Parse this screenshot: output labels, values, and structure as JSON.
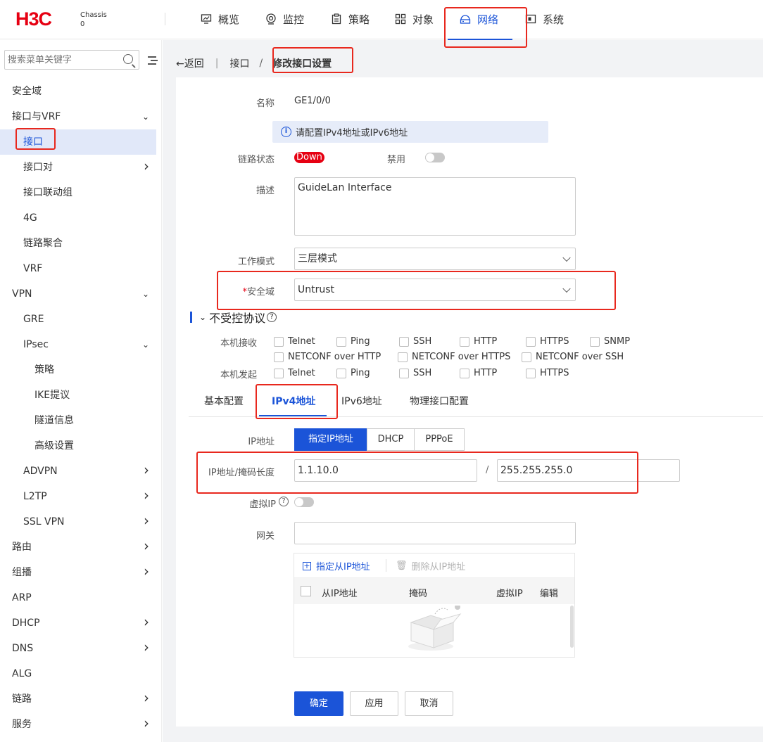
{
  "header": {
    "logo": "H3C",
    "chassis_label": "Chassis",
    "chassis_value": "0",
    "nav": [
      {
        "label": "概览",
        "icon": "monitor-icon"
      },
      {
        "label": "监控",
        "icon": "eye-icon"
      },
      {
        "label": "策略",
        "icon": "clipboard-icon"
      },
      {
        "label": "对象",
        "icon": "grid-icon"
      },
      {
        "label": "网络",
        "icon": "network-icon",
        "active": true
      },
      {
        "label": "系统",
        "icon": "system-icon"
      }
    ]
  },
  "sidebar": {
    "search_placeholder": "搜索菜单关键字",
    "items": [
      {
        "label": "安全域"
      },
      {
        "label": "接口与VRF",
        "chevron": "⌄"
      },
      {
        "label": "接口",
        "selected": true
      },
      {
        "label": "接口对",
        "chevron": "›"
      },
      {
        "label": "接口联动组"
      },
      {
        "label": "4G"
      },
      {
        "label": "链路聚合"
      },
      {
        "label": "VRF"
      },
      {
        "label": "VPN",
        "chevron": "⌄"
      },
      {
        "label": "GRE"
      },
      {
        "label": "IPsec",
        "chevron": "⌄"
      },
      {
        "label": "策略"
      },
      {
        "label": "IKE提议"
      },
      {
        "label": "隧道信息"
      },
      {
        "label": "高级设置"
      },
      {
        "label": "ADVPN",
        "chevron": "›"
      },
      {
        "label": "L2TP",
        "chevron": "›"
      },
      {
        "label": "SSL VPN",
        "chevron": "›"
      },
      {
        "label": "路由",
        "chevron": "›"
      },
      {
        "label": "组播",
        "chevron": "›"
      },
      {
        "label": "ARP"
      },
      {
        "label": "DHCP",
        "chevron": "›"
      },
      {
        "label": "DNS",
        "chevron": "›"
      },
      {
        "label": "ALG"
      },
      {
        "label": "链路",
        "chevron": "›"
      },
      {
        "label": "服务",
        "chevron": "›"
      }
    ]
  },
  "breadcrumb": {
    "back": "←返回",
    "sep1": "|",
    "level1": "接口",
    "sep2": "/",
    "current": "修改接口设置"
  },
  "form": {
    "name_label": "名称",
    "name_value": "GE1/0/0",
    "info": "请配置IPv4地址或IPv6地址",
    "link_status_label": "链路状态",
    "link_status_value": "Down",
    "disable_label": "禁用",
    "desc_label": "描述",
    "desc_value": "GuideLan Interface",
    "mode_label": "工作模式",
    "mode_value": "三层模式",
    "zone_required": "*",
    "zone_label": "安全域",
    "zone_value": "Untrust"
  },
  "protocols": {
    "title": "不受控协议",
    "help": "?",
    "receive_label": "本机接收",
    "receive": [
      "Telnet",
      "Ping",
      "SSH",
      "HTTP",
      "HTTPS",
      "SNMP",
      "NETCONF over HTTP",
      "NETCONF over HTTPS",
      "NETCONF over SSH"
    ],
    "send_label": "本机发起",
    "send": [
      "Telnet",
      "Ping",
      "SSH",
      "HTTP",
      "HTTPS"
    ]
  },
  "tabs": [
    "基本配置",
    "IPv4地址",
    "IPv6地址",
    "物理接口配置"
  ],
  "ipv4": {
    "ip_label": "IP地址",
    "modes": [
      "指定IP地址",
      "DHCP",
      "PPPoE"
    ],
    "addr_label": "IP地址/掩码长度",
    "ip_value": "1.1.10.0",
    "slash": "/",
    "mask_value": "255.255.255.0",
    "virtual_ip_label": "虚拟IP",
    "gateway_label": "网关",
    "gateway_value": "",
    "add_secondary": "指定从IP地址",
    "delete_secondary": "删除从IP地址",
    "columns": [
      "从IP地址",
      "掩码",
      "虚拟IP",
      "编辑"
    ]
  },
  "buttons": {
    "ok": "确定",
    "apply": "应用",
    "cancel": "取消"
  },
  "colors": {
    "accent": "#1b54d8",
    "brand": "#e60012",
    "highlight_box": "#e8281e"
  }
}
